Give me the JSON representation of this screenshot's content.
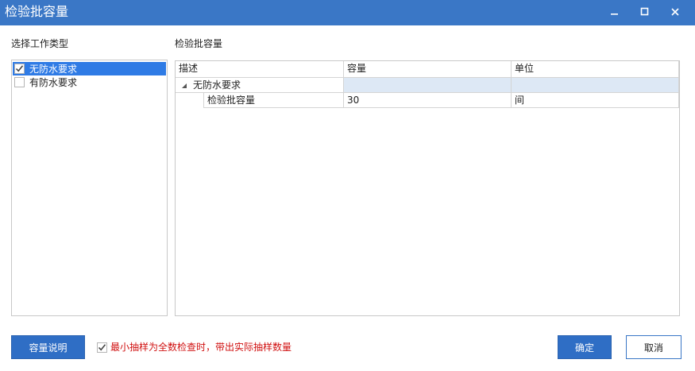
{
  "window": {
    "title": "检验批容量",
    "controls": [
      "minimize",
      "maximize",
      "close"
    ],
    "accent_color": "#3a77c6"
  },
  "work_types": {
    "label": "选择工作类型",
    "items": [
      {
        "label": "无防水要求",
        "checked": true,
        "selected": true
      },
      {
        "label": "有防水要求",
        "checked": false,
        "selected": false
      }
    ],
    "selection_color": "#2f7be5"
  },
  "capacity": {
    "label": "检验批容量",
    "columns": [
      "描述",
      "容量",
      "单位"
    ],
    "group": {
      "label": "无防水要求",
      "expanded": true
    },
    "rows": [
      {
        "desc": "检验批容量",
        "capacity": "30",
        "unit": "间"
      }
    ]
  },
  "footer": {
    "explain_label": "容量说明",
    "option_label": "最小抽样为全数检查时，带出实际抽样数量",
    "option_checked": true,
    "option_color": "#d01010",
    "ok_label": "确定",
    "cancel_label": "取消"
  }
}
